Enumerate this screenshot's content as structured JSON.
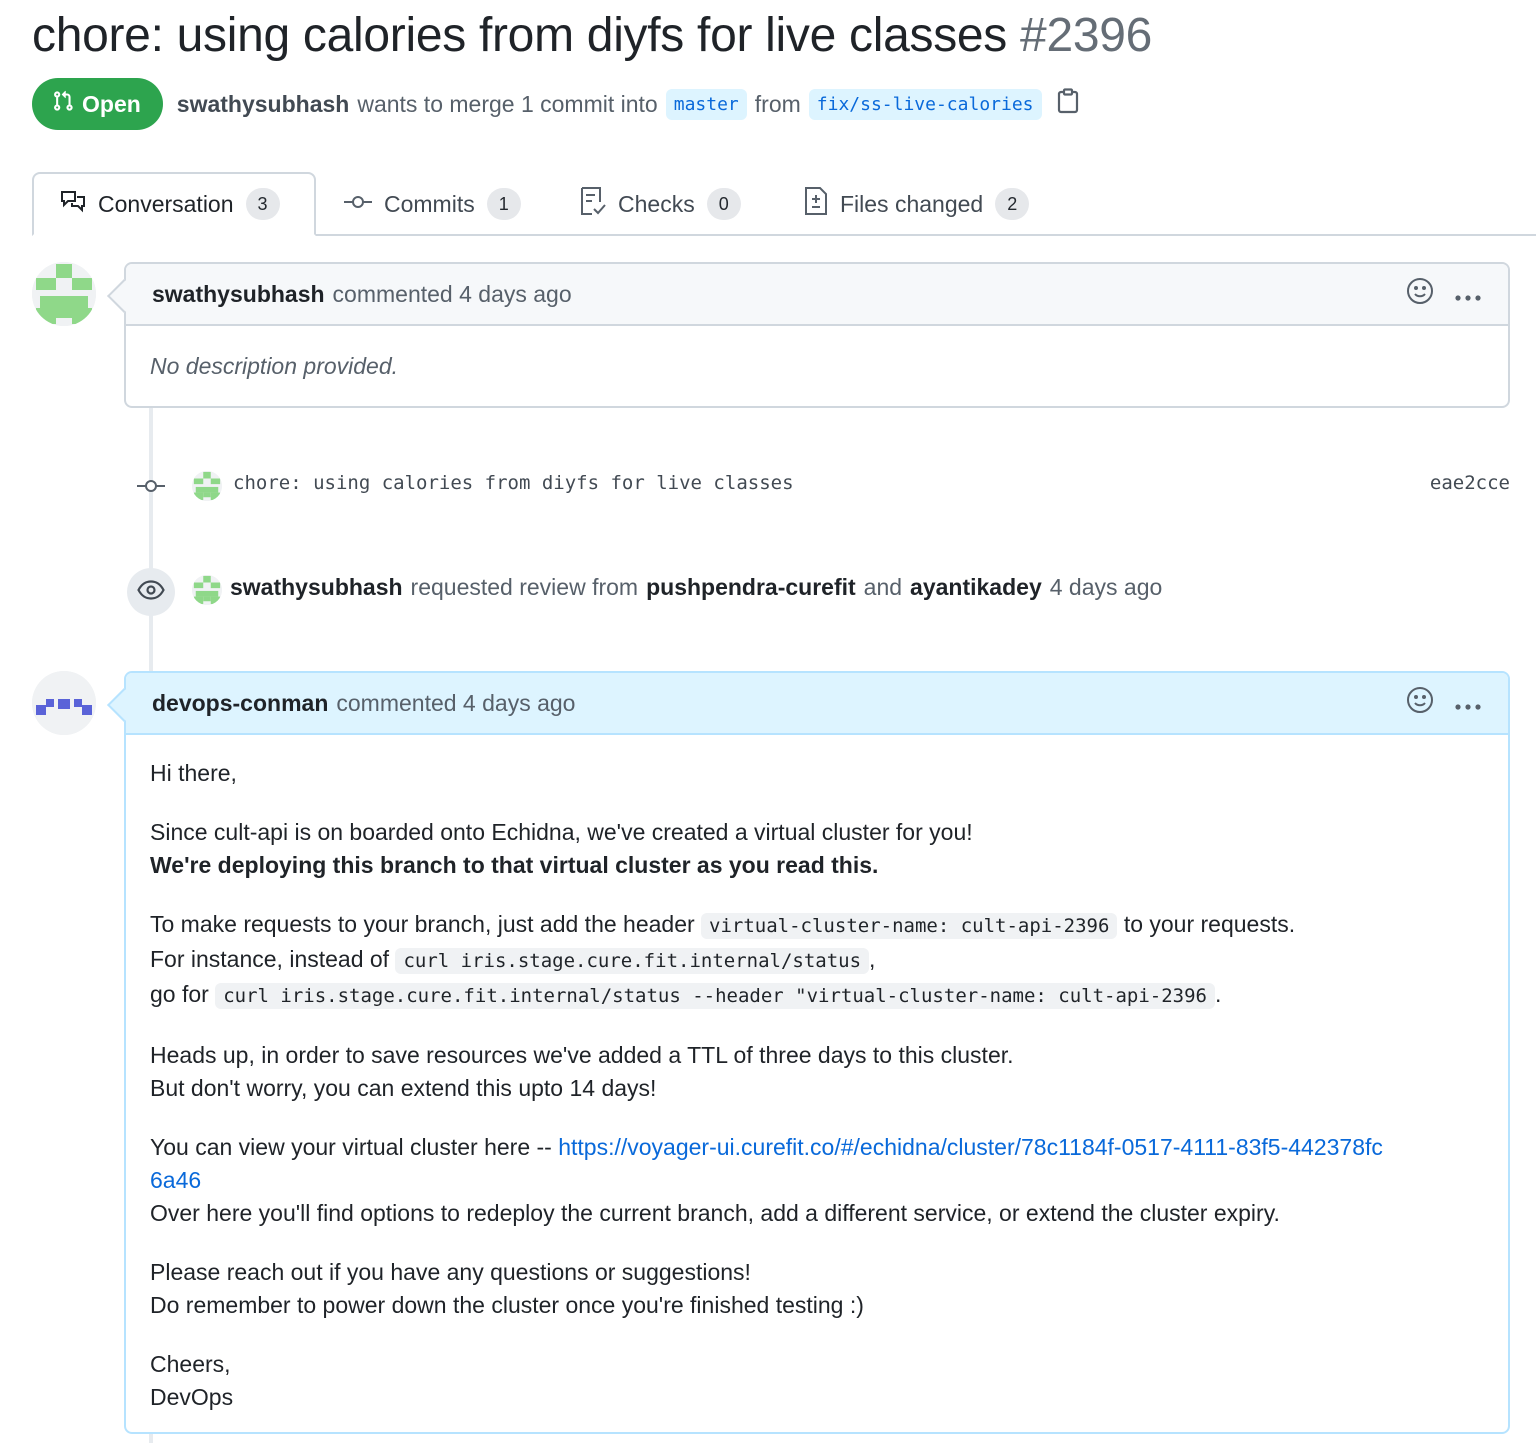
{
  "pr": {
    "title": "chore: using calories from diyfs for live classes",
    "number": "#2396",
    "state": "Open",
    "author": "swathysubhash",
    "merge_text": "wants to merge 1 commit into",
    "base_branch": "master",
    "from_text": "from",
    "head_branch": "fix/ss-live-calories"
  },
  "tabs": [
    {
      "label": "Conversation",
      "count": "3"
    },
    {
      "label": "Commits",
      "count": "1"
    },
    {
      "label": "Checks",
      "count": "0"
    },
    {
      "label": "Files changed",
      "count": "2"
    }
  ],
  "comment1": {
    "author": "swathysubhash",
    "action": "commented 4 days ago",
    "body": "No description provided."
  },
  "commit": {
    "message": "chore: using calories from diyfs for live classes",
    "sha": "eae2cce"
  },
  "review_event": {
    "actor": "swathysubhash",
    "text1": "requested review from",
    "reviewer1": "pushpendra-curefit",
    "text2": "and",
    "reviewer2": "ayantikadey",
    "time": "4 days ago"
  },
  "comment2": {
    "author": "devops-conman",
    "action": "commented 4 days ago",
    "greeting": "Hi there,",
    "p1_line1": "Since cult-api is on boarded onto Echidna, we've created a virtual cluster for you!",
    "p1_line2": "We're deploying this branch to that virtual cluster as you read this.",
    "p2_a": "To make requests to your branch, just add the header",
    "p2_code1": "virtual-cluster-name: cult-api-2396",
    "p2_b": "to your requests.",
    "p2_c": "For instance, instead of",
    "p2_code2": "curl iris.stage.cure.fit.internal/status",
    "p2_d": ",",
    "p2_e": "go for",
    "p2_code3": "curl iris.stage.cure.fit.internal/status --header \"virtual-cluster-name: cult-api-2396",
    "p2_f": ".",
    "p3_line1": "Heads up, in order to save resources we've added a TTL of three days to this cluster.",
    "p3_line2": "But don't worry, you can extend this upto 14 days!",
    "p4_a": "You can view your virtual cluster here --",
    "p4_link": "https://voyager-ui.curefit.co/#/echidna/cluster/78c1184f-0517-4111-83f5-442378fc6a46",
    "p4_b": "Over here you'll find options to redeploy the current branch, add a different service, or extend the cluster expiry.",
    "p5_line1": "Please reach out if you have any questions or suggestions!",
    "p5_line2": "Do remember to power down the cluster once you're finished testing :)",
    "p6_line1": "Cheers,",
    "p6_line2": "DevOps"
  },
  "colors": {
    "open_green": "#2da44e",
    "link_blue": "#0969da",
    "avatar1_green": "#8fd889",
    "avatar2_indigo": "#5a63d8"
  },
  "icons": [
    "git-pull-request-icon",
    "copy-icon",
    "comment-discussion-icon",
    "git-commit-icon",
    "checklist-icon",
    "file-diff-icon",
    "smiley-icon",
    "kebab-horizontal-icon",
    "eye-icon"
  ]
}
